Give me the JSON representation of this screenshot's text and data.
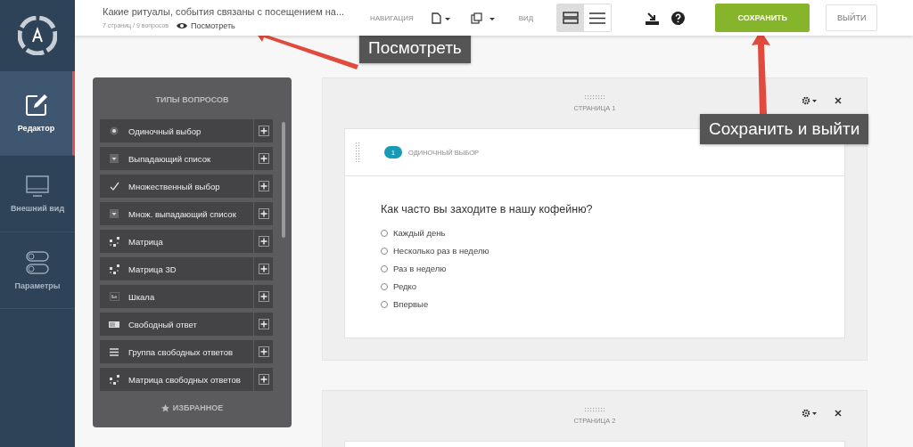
{
  "header": {
    "title": "Какие ритуалы, события связаны с посещением на...",
    "stats": "7 страниц / 9 вопросов",
    "preview_link": "Посмотреть",
    "navigation_label": "НАВИГАЦИЯ",
    "view_label": "ВИД",
    "view_modes": [
      {
        "kind": "blocks",
        "selected": true
      },
      {
        "kind": "list",
        "selected": false
      }
    ],
    "save_button": "СОХРАНИТЬ",
    "exit_button": "ВЫЙТИ"
  },
  "sidebar": {
    "items": [
      {
        "kind": "editor",
        "label": "Редактор",
        "selected": true
      },
      {
        "kind": "appearance",
        "label": "Внешний вид",
        "selected": false
      },
      {
        "kind": "settings",
        "label": "Параметры",
        "selected": false
      }
    ]
  },
  "question_types": {
    "title": "ТИПЫ ВОПРОСОВ",
    "items": [
      {
        "kind": "radio",
        "label": "Одиночный выбор"
      },
      {
        "kind": "dropdown",
        "label": "Выпадающий список"
      },
      {
        "kind": "check",
        "label": "Множественный выбор"
      },
      {
        "kind": "dropdown",
        "label": "Множ. выпадающий список"
      },
      {
        "kind": "matrix",
        "label": "Матрица"
      },
      {
        "kind": "matrix",
        "label": "Матрица 3D"
      },
      {
        "kind": "scale",
        "label": "Шкала"
      },
      {
        "kind": "text",
        "label": "Свободный ответ"
      },
      {
        "kind": "textgroup",
        "label": "Группа свободных ответов"
      },
      {
        "kind": "matrix",
        "label": "Матрица свободных ответов"
      }
    ],
    "favorites": "ИЗБРАННОЕ"
  },
  "pages": [
    {
      "title": "СТРАНИЦА 1",
      "questions": [
        {
          "number": "1",
          "type": "ОДИНОЧНЫЙ ВЫБОР",
          "text": "Как часто вы заходите в нашу кофейню?",
          "options": [
            {
              "label": "Каждый день",
              "selected": false
            },
            {
              "label": "Несколько раз в неделю",
              "selected": false
            },
            {
              "label": "Раз в неделю",
              "selected": false
            },
            {
              "label": "Редко",
              "selected": false
            },
            {
              "label": "Впервые",
              "selected": false
            }
          ]
        }
      ]
    },
    {
      "title": "СТРАНИЦА 2"
    }
  ],
  "callouts": [
    {
      "text": "Посмотреть"
    },
    {
      "text": "Сохранить и выйти"
    }
  ]
}
